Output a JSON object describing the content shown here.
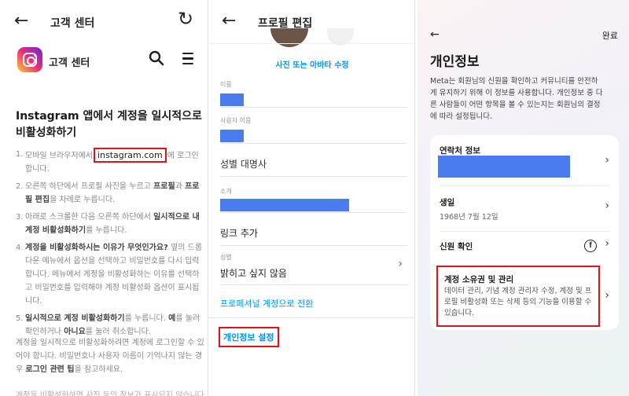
{
  "help": {
    "back_icon": "back-arrow-icon",
    "top_title": "고객 센터",
    "refresh_icon": "refresh-icon",
    "brand_name": "고객 센터",
    "search_icon": "search-icon",
    "menu_icon": "menu-icon",
    "article_title": "Instagram 앱에서 계정을 일시적으로 비활성화하기",
    "step1": {
      "num": "1.",
      "before": "모바일 브라우저에서",
      "highlight": "instagram.com",
      "after": "에 로그인합니다."
    },
    "step2": {
      "num": "2.",
      "t1": "오른쪽 하단에서 프로필 사진을 누르고 ",
      "b1": "프로필",
      "t2": "과 ",
      "b2": "프로필 편집",
      "t3": "을 차례로 누릅니다."
    },
    "step3": {
      "num": "3.",
      "t1": "아래로 스크롤한 다음 오른쪽 하단에서 ",
      "b1": "일시적으로 내 계정 비활성화하기",
      "t2": "를 누릅니다."
    },
    "step4": {
      "num": "4.",
      "b1": "계정을 비활성화하시는 이유가 무엇인가요?",
      "t1": " 옆의 드롭다운 메뉴에서 옵션을 선택하고 비밀번호를 다시 입력합니다. 메뉴에서 계정을 비활성화하는 이유를 선택하고 비밀번호를 입력해야 계정 비활성화 옵션이 표시됩니다."
    },
    "step5": {
      "num": "5.",
      "b1": "일시적으로 계정 비활성화하기",
      "t1": "를 누릅니다. ",
      "b2": "예",
      "t2": "를 눌러 확인하거나 ",
      "b3": "아니요",
      "t3": "를 눌러 취소합니다."
    },
    "footer": {
      "t1": "계정을 일시적으로 비활성화하려면 계정에 로그인할 수 있어야 합니다. 비밀번호나 사용자 이름이 기억나지 않는 경우 ",
      "b1": "로그인 관련 팁",
      "t2": "을 참고하세요."
    },
    "footer_cut": "계정을 비활성화하면 사진 등의 정보가 표시되지 않습니다"
  },
  "edit": {
    "back_icon": "back-arrow-icon",
    "title": "프로필 편집",
    "photo_link": "사진 또는 아바타 수정",
    "name_label": "이름",
    "username_label": "사용자 이름",
    "pronouns": "성별 대명사",
    "bio_label": "소개",
    "add_link": "링크 추가",
    "gender_label": "성별",
    "gender_value": "밝히고 싶지 않음",
    "pro_link": "프로페셔널 계정으로 전환",
    "privacy_button": "개인정보 설정"
  },
  "privacy": {
    "back_icon": "back-arrow-icon",
    "done": "완료",
    "title": "개인정보",
    "desc": "Meta는 회원님의 신원을 확인하고 커뮤니티를 안전하게 유지하기 위해 이 정보를 사용합니다. 개인정보 중 다른 사람들이 어떤 항목을 볼 수 있는지는 회원님의 결정에 따라 설정됩니다.",
    "contact_title": "연락처 정보",
    "birthday_title": "생일",
    "birthday_value": "1968년 7월 12일",
    "identity_title": "신원 확인",
    "facebook_icon": "facebook-icon",
    "ownership_title": "계정 소유권 및 관리",
    "ownership_desc": "데이터 관리, 기념 계정 관리자 수정, 계정 및 프로필 비활성화 또는 삭제 등의 기능을 이용할 수 있습니다.",
    "chevron": "›"
  },
  "colors": {
    "highlight_box": "#e0131a",
    "redaction": "#4a7cf0",
    "link_blue": "#0095f6"
  }
}
